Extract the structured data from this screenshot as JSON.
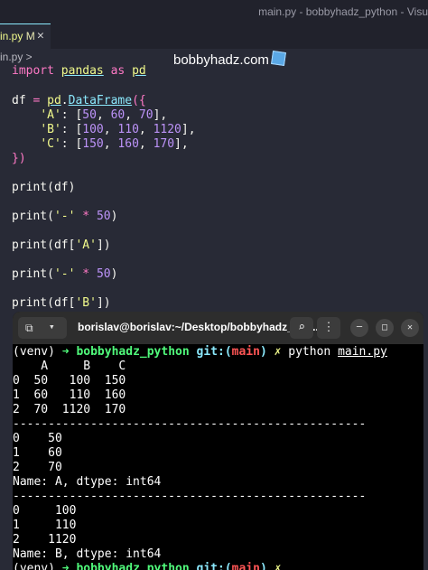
{
  "window": {
    "title": "main.py - bobbyhadz_python - Visu"
  },
  "tab": {
    "label": "in.py",
    "modified": "M",
    "close": "✕"
  },
  "brand": {
    "text": "bobbyhadz.com"
  },
  "breadcrumb": {
    "text": "in.py >"
  },
  "code": {
    "l1": {
      "import": "import",
      "module": "pandas",
      "as": "as",
      "alias": "pd"
    },
    "l2": {
      "var": "df",
      "eq": "=",
      "obj": "pd",
      "dot": ".",
      "cls": "DataFrame",
      "open": "({"
    },
    "l3": {
      "indent": "    ",
      "key": "'A'",
      "colon": ": [",
      "v1": "50",
      "c1": ", ",
      "v2": "60",
      "c2": ", ",
      "v3": "70",
      "close": "],"
    },
    "l4": {
      "indent": "    ",
      "key": "'B'",
      "colon": ": [",
      "v1": "100",
      "c1": ", ",
      "v2": "110",
      "c2": ", ",
      "v3": "1120",
      "close": "],"
    },
    "l5": {
      "indent": "    ",
      "key": "'C'",
      "colon": ": [",
      "v1": "150",
      "c1": ", ",
      "v2": "160",
      "c2": ", ",
      "v3": "170",
      "close": "],"
    },
    "l6": "})",
    "l7": {
      "fn": "print",
      "args": "(df)"
    },
    "l8": {
      "fn": "print",
      "open": "(",
      "str": "'-'",
      "op": " * ",
      "num": "50",
      "close": ")"
    },
    "l9": {
      "fn": "print",
      "open": "(df[",
      "str": "'A'",
      "close": "])"
    },
    "l10": {
      "fn": "print",
      "open": "(",
      "str": "'-'",
      "op": " * ",
      "num": "50",
      "close": ")"
    },
    "l11": {
      "fn": "print",
      "open": "(df[",
      "str": "'B'",
      "close": "])"
    }
  },
  "terminal": {
    "title": "borislav@borislav:~/Desktop/bobbyhadz_pyt...",
    "new_tab_icon": "⧉",
    "dropdown_icon": "▾",
    "search_icon": "⌕",
    "menu_icon": "⋮",
    "min_icon": "─",
    "max_icon": "□",
    "close_icon": "✕",
    "prompt": {
      "venv": "(venv) ",
      "arrow": "➜",
      "project": "bobbyhadz_python",
      "git": "git:(",
      "branch": "main",
      "git_close": ")",
      "dirty": "✗",
      "cmd": "python ",
      "arg": "main.py"
    },
    "out": [
      "    A     B    C",
      "0  50   100  150",
      "1  60   110  160",
      "2  70  1120  170",
      "--------------------------------------------------",
      "0    50",
      "1    60",
      "2    70",
      "Name: A, dtype: int64",
      "--------------------------------------------------",
      "0     100",
      "1     110",
      "2    1120",
      "Name: B, dtype: int64"
    ]
  }
}
